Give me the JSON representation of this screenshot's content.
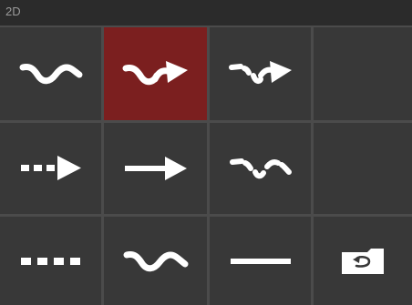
{
  "header": {
    "title": "2D"
  },
  "colors": {
    "selected": "#7b1f1f",
    "cell": "#383838",
    "divider": "#4b4b4b",
    "icon": "#ffffff"
  },
  "palette": {
    "rows": [
      [
        {
          "icon": "wavy-line-icon",
          "selected": false
        },
        {
          "icon": "wavy-arrow-icon",
          "selected": true
        },
        {
          "icon": "broken-wavy-arrow-icon",
          "selected": false
        },
        {
          "icon": "",
          "selected": false
        }
      ],
      [
        {
          "icon": "dashed-arrow-icon",
          "selected": false
        },
        {
          "icon": "straight-arrow-icon",
          "selected": false
        },
        {
          "icon": "broken-wavy-line-icon",
          "selected": false
        },
        {
          "icon": "",
          "selected": false
        }
      ],
      [
        {
          "icon": "dashed-line-icon",
          "selected": false
        },
        {
          "icon": "wavy-line-icon",
          "selected": false
        },
        {
          "icon": "solid-line-icon",
          "selected": false
        },
        {
          "icon": "folder-back-icon",
          "selected": false
        }
      ]
    ]
  }
}
